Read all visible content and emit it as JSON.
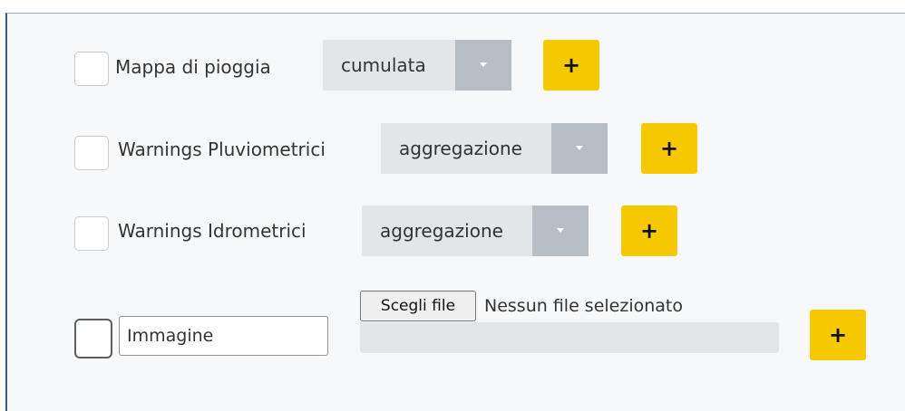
{
  "form": {
    "rows": [
      {
        "label": "Mappa di pioggia",
        "select_value": "cumulata",
        "add_label": "+"
      },
      {
        "label": "Warnings Pluviometrici",
        "select_value": "aggregazione",
        "add_label": "+"
      },
      {
        "label": "Warnings Idrometrici",
        "select_value": "aggregazione",
        "add_label": "+"
      }
    ],
    "image_row": {
      "name_value": "Immagine",
      "file_button_label": "Scegli file",
      "file_status": "Nessun file selezionato",
      "add_label": "+"
    }
  },
  "icons": {
    "dropdown": "chevron-down-icon",
    "add": "plus-icon"
  },
  "colors": {
    "accent_button": "#f6c800",
    "select_background": "#e3e6e9",
    "select_caret_background": "#b7bec5"
  }
}
